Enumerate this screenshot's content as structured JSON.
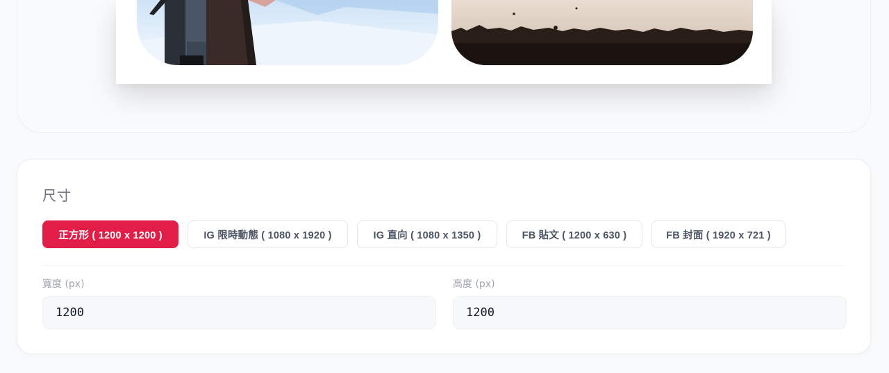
{
  "size_section": {
    "title": "尺寸",
    "presets": [
      {
        "label": "正方形 ( 1200 x 1200 )",
        "active": true
      },
      {
        "label": "IG 限時動態 ( 1080 x 1920 )",
        "active": false
      },
      {
        "label": "IG 直向 ( 1080 x 1350 )",
        "active": false
      },
      {
        "label": "FB 貼文 ( 1200 x 630 )",
        "active": false
      },
      {
        "label": "FB 封面 ( 1920 x 721 )",
        "active": false
      }
    ],
    "width": {
      "label": "寬度 (px)",
      "value": "1200"
    },
    "height": {
      "label": "高度 (px)",
      "value": "1200"
    }
  },
  "colors": {
    "accent": "#e11d48"
  }
}
